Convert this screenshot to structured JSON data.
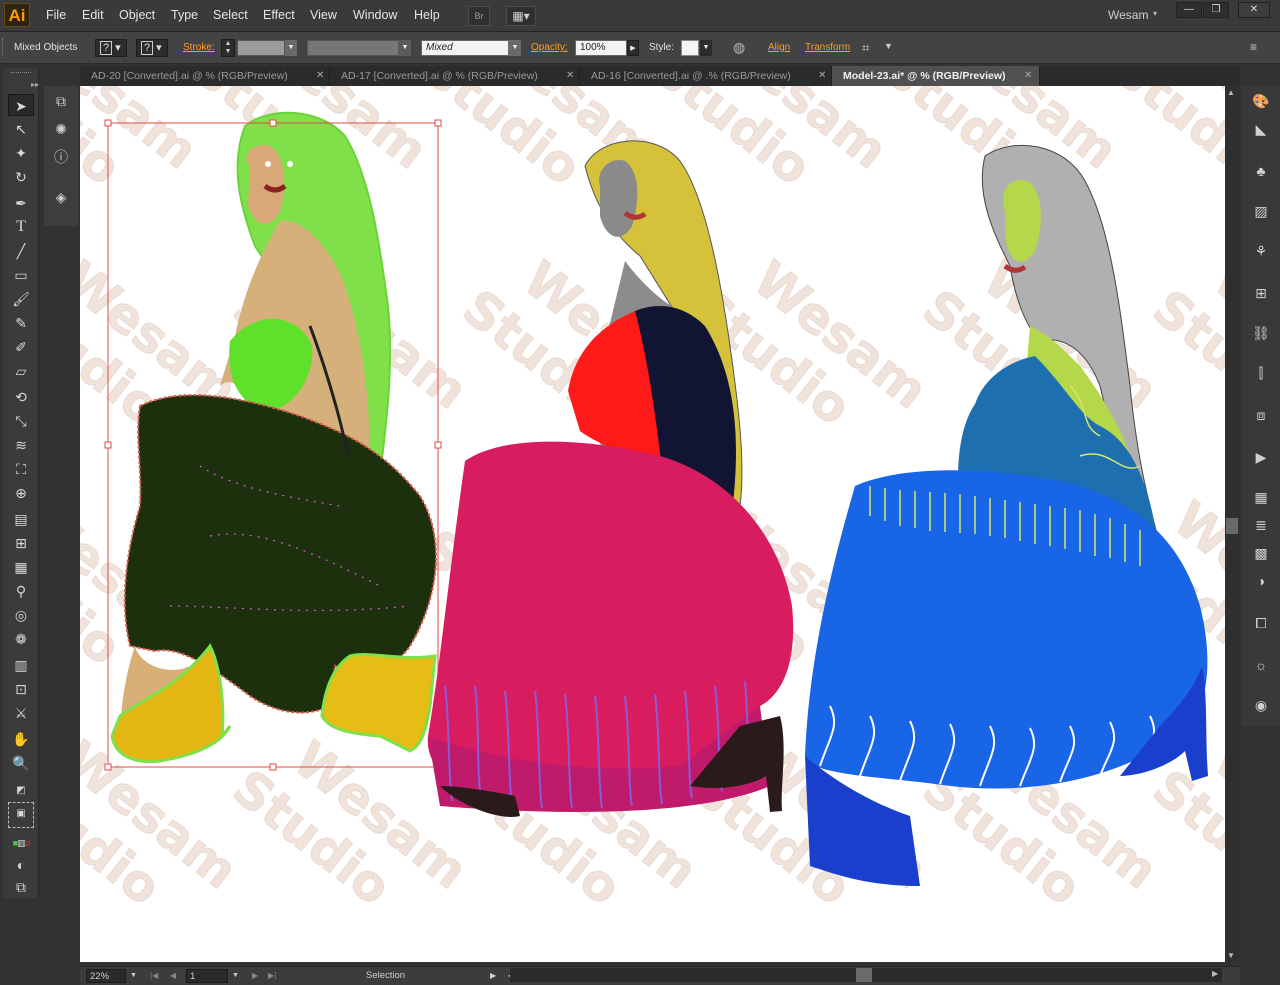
{
  "app": {
    "logo": "Ai",
    "user": "Wesam"
  },
  "menu": [
    "File",
    "Edit",
    "Object",
    "Type",
    "Select",
    "Effect",
    "View",
    "Window",
    "Help"
  ],
  "menubar_buttons": {
    "bridge": "Br"
  },
  "control": {
    "selection_label": "Mixed Objects",
    "fill_q": "?",
    "stroke_q": "?",
    "stroke_label": "Stroke:",
    "brush_value": "Mixed",
    "opacity_label": "Opacity:",
    "opacity_value": "100%",
    "style_label": "Style:",
    "align_label": "Align",
    "transform_label": "Transform"
  },
  "tabs": [
    {
      "label": "AD-20 [Converted].ai @ % (RGB/Preview)",
      "active": false
    },
    {
      "label": "AD-17 [Converted].ai @ % (RGB/Preview)",
      "active": false
    },
    {
      "label": "AD-16 [Converted].ai @ .% (RGB/Preview)",
      "active": false
    },
    {
      "label": "Model-23.ai* @ % (RGB/Preview)",
      "active": true
    }
  ],
  "watermark": {
    "line1": "Wesam",
    "line2": "Studio"
  },
  "status": {
    "zoom": "22%",
    "page": "1",
    "tool": "Selection"
  },
  "colors": {
    "accent": "#ff9c27",
    "canvas": "#ffffff",
    "workspace": "#323232"
  }
}
